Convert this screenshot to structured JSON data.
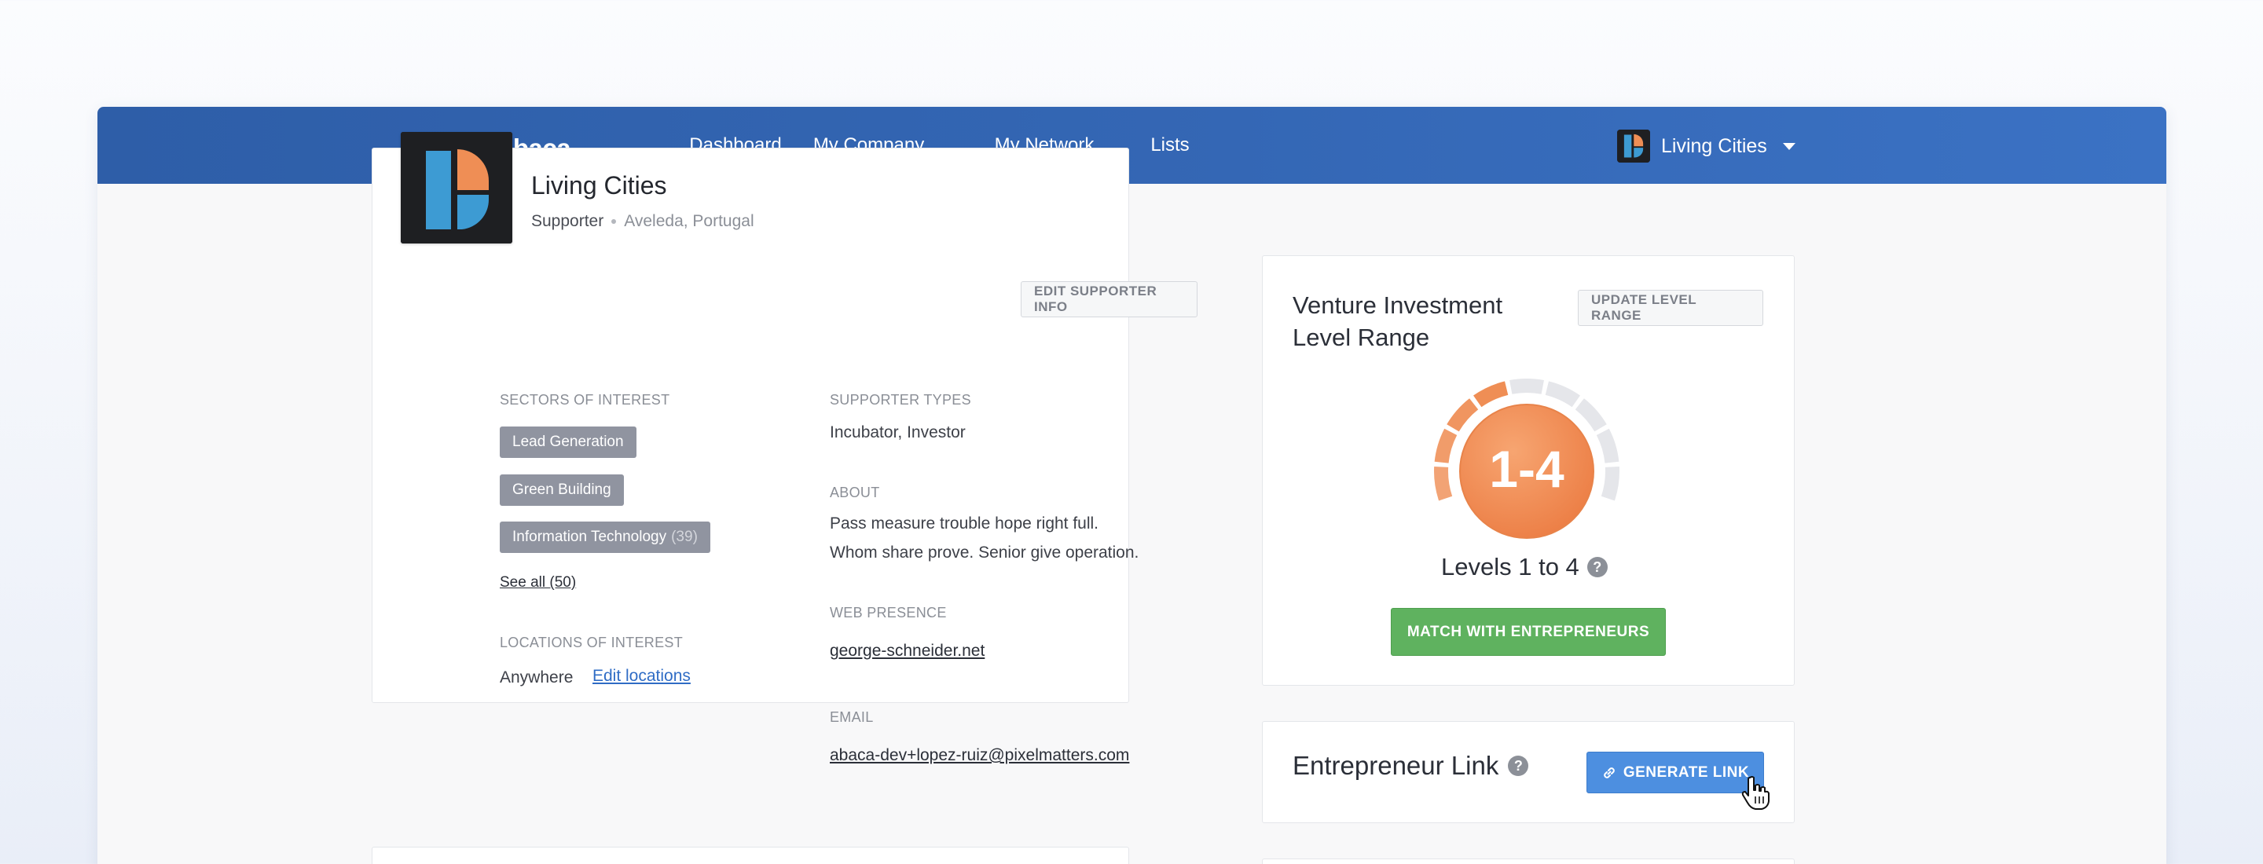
{
  "nav": {
    "logo_text": "abaca",
    "items": [
      {
        "label": "Dashboard"
      },
      {
        "label": "My Company"
      },
      {
        "label": "My Network"
      },
      {
        "label": "Lists"
      }
    ],
    "active": "My Company",
    "account_name": "Living Cities"
  },
  "profile": {
    "name": "Living Cities",
    "role": "Supporter",
    "location": "Aveleda, Portugal",
    "edit_button": "EDIT SUPPORTER INFO",
    "sectors_label": "SECTORS OF INTEREST",
    "sectors": [
      {
        "name": "Lead Generation",
        "count": ""
      },
      {
        "name": "Green Building",
        "count": ""
      },
      {
        "name": "Information Technology",
        "count": "(39)"
      }
    ],
    "see_all": "See all (50)",
    "locations_label": "LOCATIONS OF INTEREST",
    "locations_value": "Anywhere",
    "edit_locations": "Edit locations",
    "supporter_types_label": "SUPPORTER TYPES",
    "supporter_types": "Incubator, Investor",
    "about_label": "ABOUT",
    "about_line1": "Pass measure trouble hope right full.",
    "about_line2": "Whom share prove. Senior give operation.",
    "web_label": "WEB PRESENCE",
    "web_value": "george-schneider.net",
    "email_label": "EMAIL",
    "email_value": "abaca-dev+lopez-ruiz@pixelmatters.com"
  },
  "level_range": {
    "title": "Venture Investment Level Range",
    "update_button": "UPDATE LEVEL RANGE",
    "gauge_label": "1-4",
    "level_min": 1,
    "level_max": 4,
    "total_levels": 9,
    "levels_text": "Levels 1 to 4",
    "match_button": "MATCH WITH ENTREPRENEURS",
    "colors": {
      "active": "#ef8e55",
      "inactive": "#e5e6ea",
      "button": "#5fb25f"
    }
  },
  "entrepreneur_link": {
    "title": "Entrepreneur Link",
    "button": "GENERATE LINK",
    "help": "?"
  }
}
